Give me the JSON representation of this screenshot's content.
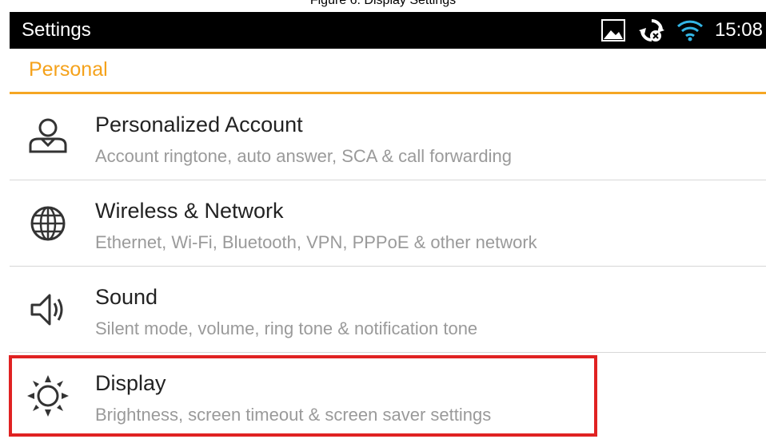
{
  "caption": "Figure 6: Display Settings",
  "status_bar": {
    "title": "Settings",
    "time": "15:08",
    "icons": [
      "image-notification-icon",
      "sync-icon",
      "wifi-icon"
    ]
  },
  "section": {
    "title": "Personal",
    "accent_color": "#f5a623"
  },
  "items": [
    {
      "title": "Personalized Account",
      "subtitle": "Account ringtone, auto answer, SCA & call forwarding",
      "icon": "account-icon"
    },
    {
      "title": "Wireless & Network",
      "subtitle": "Ethernet, Wi-Fi, Bluetooth, VPN, PPPoE & other network",
      "icon": "globe-icon"
    },
    {
      "title": "Sound",
      "subtitle": "Silent mode, volume, ring tone & notification tone",
      "icon": "speaker-icon"
    },
    {
      "title": "Display",
      "subtitle": "Brightness, screen timeout & screen saver settings",
      "icon": "brightness-icon"
    }
  ],
  "highlight_color": "#e02222"
}
